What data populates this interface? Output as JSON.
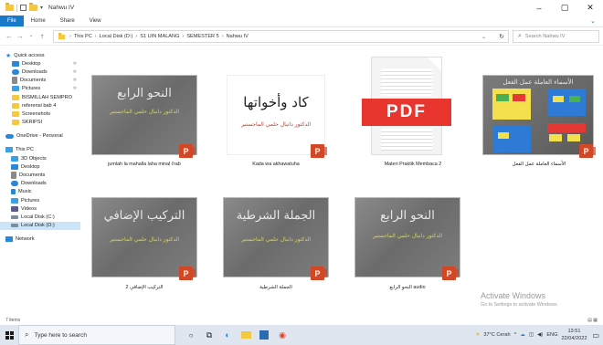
{
  "window": {
    "title": "Nahwu IV",
    "minimize": "–",
    "maximize": "▢",
    "close": "✕"
  },
  "ribbon": {
    "tabs": [
      "File",
      "Home",
      "Share",
      "View"
    ]
  },
  "address": {
    "crumbs": [
      "This PC",
      "Local Disk (D:)",
      "S1 UIN MALANG",
      "SEMESTER 5",
      "Nahwu IV"
    ],
    "search_placeholder": "Search Nahwu IV"
  },
  "sidebar": {
    "quick_access": "Quick access",
    "items": [
      {
        "label": "Desktop",
        "pinned": true,
        "icon": "desktop-icon",
        "color": "#2b88d8"
      },
      {
        "label": "Downloads",
        "pinned": true,
        "icon": "download-icon",
        "color": "#2b88d8"
      },
      {
        "label": "Documents",
        "pinned": true,
        "icon": "documents-icon",
        "color": "#8a8a8a"
      },
      {
        "label": "Pictures",
        "pinned": true,
        "icon": "pictures-icon",
        "color": "#3ba0e6"
      },
      {
        "label": "BISMILLAH SEMPRO",
        "pinned": false,
        "icon": "folder-icon",
        "color": "#f5c842"
      },
      {
        "label": "referensi bab 4",
        "pinned": false,
        "icon": "folder-icon",
        "color": "#f5c842"
      },
      {
        "label": "Screenshots",
        "pinned": false,
        "icon": "folder-icon",
        "color": "#f5c842"
      },
      {
        "label": "SKRIPSI",
        "pinned": false,
        "icon": "folder-icon",
        "color": "#f5c842"
      }
    ],
    "onedrive": "OneDrive - Personal",
    "this_pc": "This PC",
    "pc_items": [
      {
        "label": "3D Objects",
        "icon": "cube-icon",
        "color": "#3ba0e6"
      },
      {
        "label": "Desktop",
        "icon": "desktop-icon",
        "color": "#2b88d8"
      },
      {
        "label": "Documents",
        "icon": "documents-icon",
        "color": "#8a8a8a"
      },
      {
        "label": "Downloads",
        "icon": "download-icon",
        "color": "#2b88d8"
      },
      {
        "label": "Music",
        "icon": "music-icon",
        "color": "#2b88d8"
      },
      {
        "label": "Pictures",
        "icon": "pictures-icon",
        "color": "#3ba0e6"
      },
      {
        "label": "Videos",
        "icon": "video-icon",
        "color": "#5c5c8a"
      },
      {
        "label": "Local Disk (C:)",
        "icon": "drive-icon",
        "color": "#7f8c99"
      },
      {
        "label": "Local Disk (D:)",
        "icon": "drive-icon",
        "color": "#7f8c99"
      }
    ],
    "network": "Network"
  },
  "files": [
    {
      "caption": "jumlah la mahalla laha minal i'rab",
      "type": "pptx",
      "title": "النحو الرابع",
      "subtitle": "الدكتور دانيال حلمي الماجستير"
    },
    {
      "caption": "Kada wa akhawatuha",
      "type": "pptx",
      "title": "كاد وأخواتها",
      "subtitle": "الدكتور دانيال حلمي الماجستير"
    },
    {
      "caption": "Materi Praktik Membaca 2",
      "type": "pdf",
      "badge": "PDF"
    },
    {
      "caption": "الأسماء العاملة عمل الفعل",
      "type": "pptx",
      "title": "الأسماء العاملة عمل الفعل"
    },
    {
      "caption": "التركيب الإضافي 2",
      "type": "pptx",
      "title": "التركيب الإضافي",
      "subtitle": "الدكتور دانيال حلمي الماجستير"
    },
    {
      "caption": "الجملة الشرطية",
      "type": "pptx",
      "title": "الجملة الشرطية",
      "subtitle": "الدكتور دانيال حلمي الماجستير"
    },
    {
      "caption": "النحو الرابع audio",
      "type": "pptx",
      "title": "النحو الرابع",
      "subtitle": "الدكتور دانيال حلمي الماجستير"
    }
  ],
  "watermark": {
    "line1": "Activate Windows",
    "line2": "Go to Settings to activate Windows."
  },
  "status": {
    "items": "7 items"
  },
  "taskbar": {
    "search_placeholder": "Type here to search",
    "weather": "37°C Cerah",
    "lang": "ENG",
    "time": "13:51",
    "date": "22/04/2022"
  }
}
